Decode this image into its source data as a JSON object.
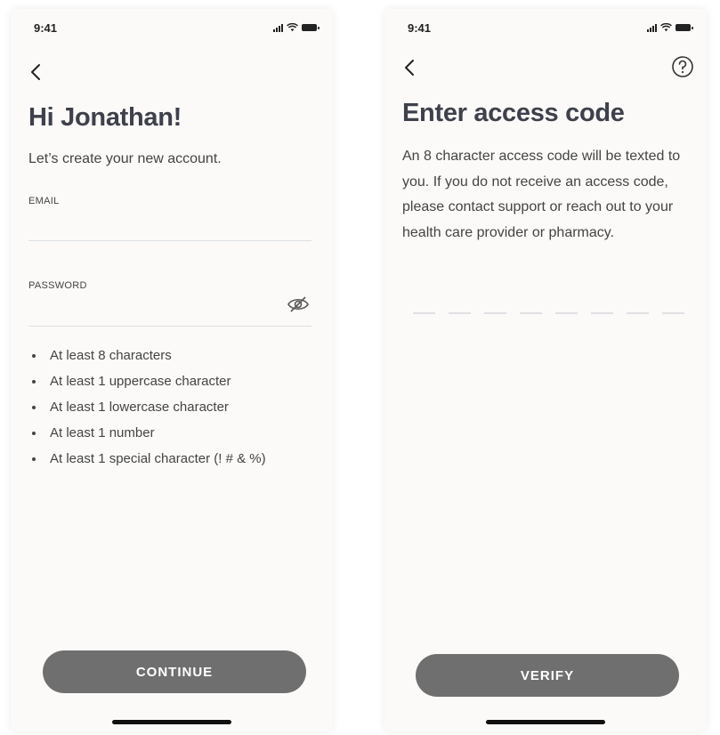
{
  "left_screen": {
    "status": {
      "time": "9:41"
    },
    "title": "Hi Jonathan!",
    "subtitle": "Let’s create your new account.",
    "email": {
      "label": "EMAIL",
      "value": "",
      "placeholder": ""
    },
    "password": {
      "label": "PASSWORD",
      "value": "",
      "placeholder": ""
    },
    "rules": [
      "At least 8 characters",
      "At least 1 uppercase character",
      "At least 1 lowercase character",
      "At least 1 number",
      "At least 1 special character (! # & %)"
    ],
    "button_label": "CONTINUE"
  },
  "right_screen": {
    "status": {
      "time": "9:41"
    },
    "title": "Enter access code",
    "body": "An 8 character access code will be texted to you. If you do not receive an access code, please contact support or reach out to your health care provider or pharmacy.",
    "code_slots": 8,
    "button_label": "VERIFY"
  },
  "icons": {
    "back": "chevron-left-icon",
    "help": "question-circle-icon",
    "password_toggle": "eye-off-icon"
  },
  "colors": {
    "background": "#fbfaf8",
    "title": "#3e414b",
    "button": "#6f6f6f",
    "button_text": "#ffffff",
    "divider": "#dcdde2"
  }
}
